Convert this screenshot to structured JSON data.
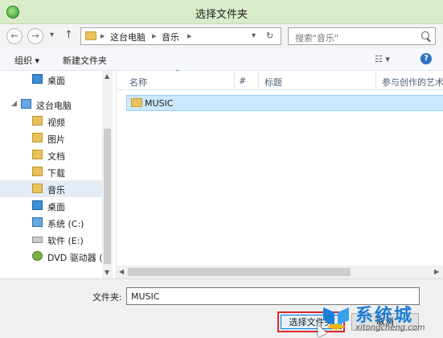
{
  "window": {
    "title": "选择文件夹",
    "icon": "green-orb-icon"
  },
  "navbar": {
    "back_icon": "back-arrow-icon",
    "forward_icon": "forward-arrow-icon",
    "recent_icon": "chevron-down-icon",
    "up_icon": "up-arrow-icon",
    "breadcrumb": [
      "这台电脑",
      "音乐"
    ],
    "breadcrumb_sep": "▸",
    "search_placeholder": "搜索\"音乐\""
  },
  "toolbar": {
    "organize_label": "组织 ▾",
    "new_folder_label": "新建文件夹",
    "view_label": "☷ ▾",
    "help_label": "?"
  },
  "nav_items": [
    {
      "label": "桌面",
      "icon": "desktop-icon"
    },
    {
      "label": "这台电脑",
      "icon": "computer-icon"
    },
    {
      "label": "视频",
      "icon": "videos-library-icon"
    },
    {
      "label": "图片",
      "icon": "pictures-library-icon"
    },
    {
      "label": "文档",
      "icon": "documents-library-icon"
    },
    {
      "label": "下载",
      "icon": "downloads-library-icon"
    },
    {
      "label": "音乐",
      "icon": "music-library-icon",
      "selected": true
    },
    {
      "label": "桌面",
      "icon": "desktop-folder-icon"
    },
    {
      "label": "系统 (C:)",
      "icon": "system-drive-icon"
    },
    {
      "label": "软件 (E:)",
      "icon": "drive-icon"
    },
    {
      "label": "DVD 驱动器 (",
      "icon": "dvd-drive-icon"
    }
  ],
  "columns": [
    "名称",
    "#",
    "标题",
    "参与创作的艺术"
  ],
  "files": [
    {
      "name": "MUSIC",
      "icon": "folder-icon",
      "selected": true
    }
  ],
  "bottom": {
    "folder_label": "文件夹:",
    "folder_value": "MUSIC",
    "select_button": "选择文件夹",
    "cancel_button": "取消"
  },
  "watermark": {
    "title": "系统城",
    "url": "xitongcheng.com"
  },
  "colors": {
    "titlebar": "#d9ecc9",
    "selection": "#cce8ff",
    "highlight_box": "#e02525",
    "watermark_blue": "#1b7fd6"
  }
}
